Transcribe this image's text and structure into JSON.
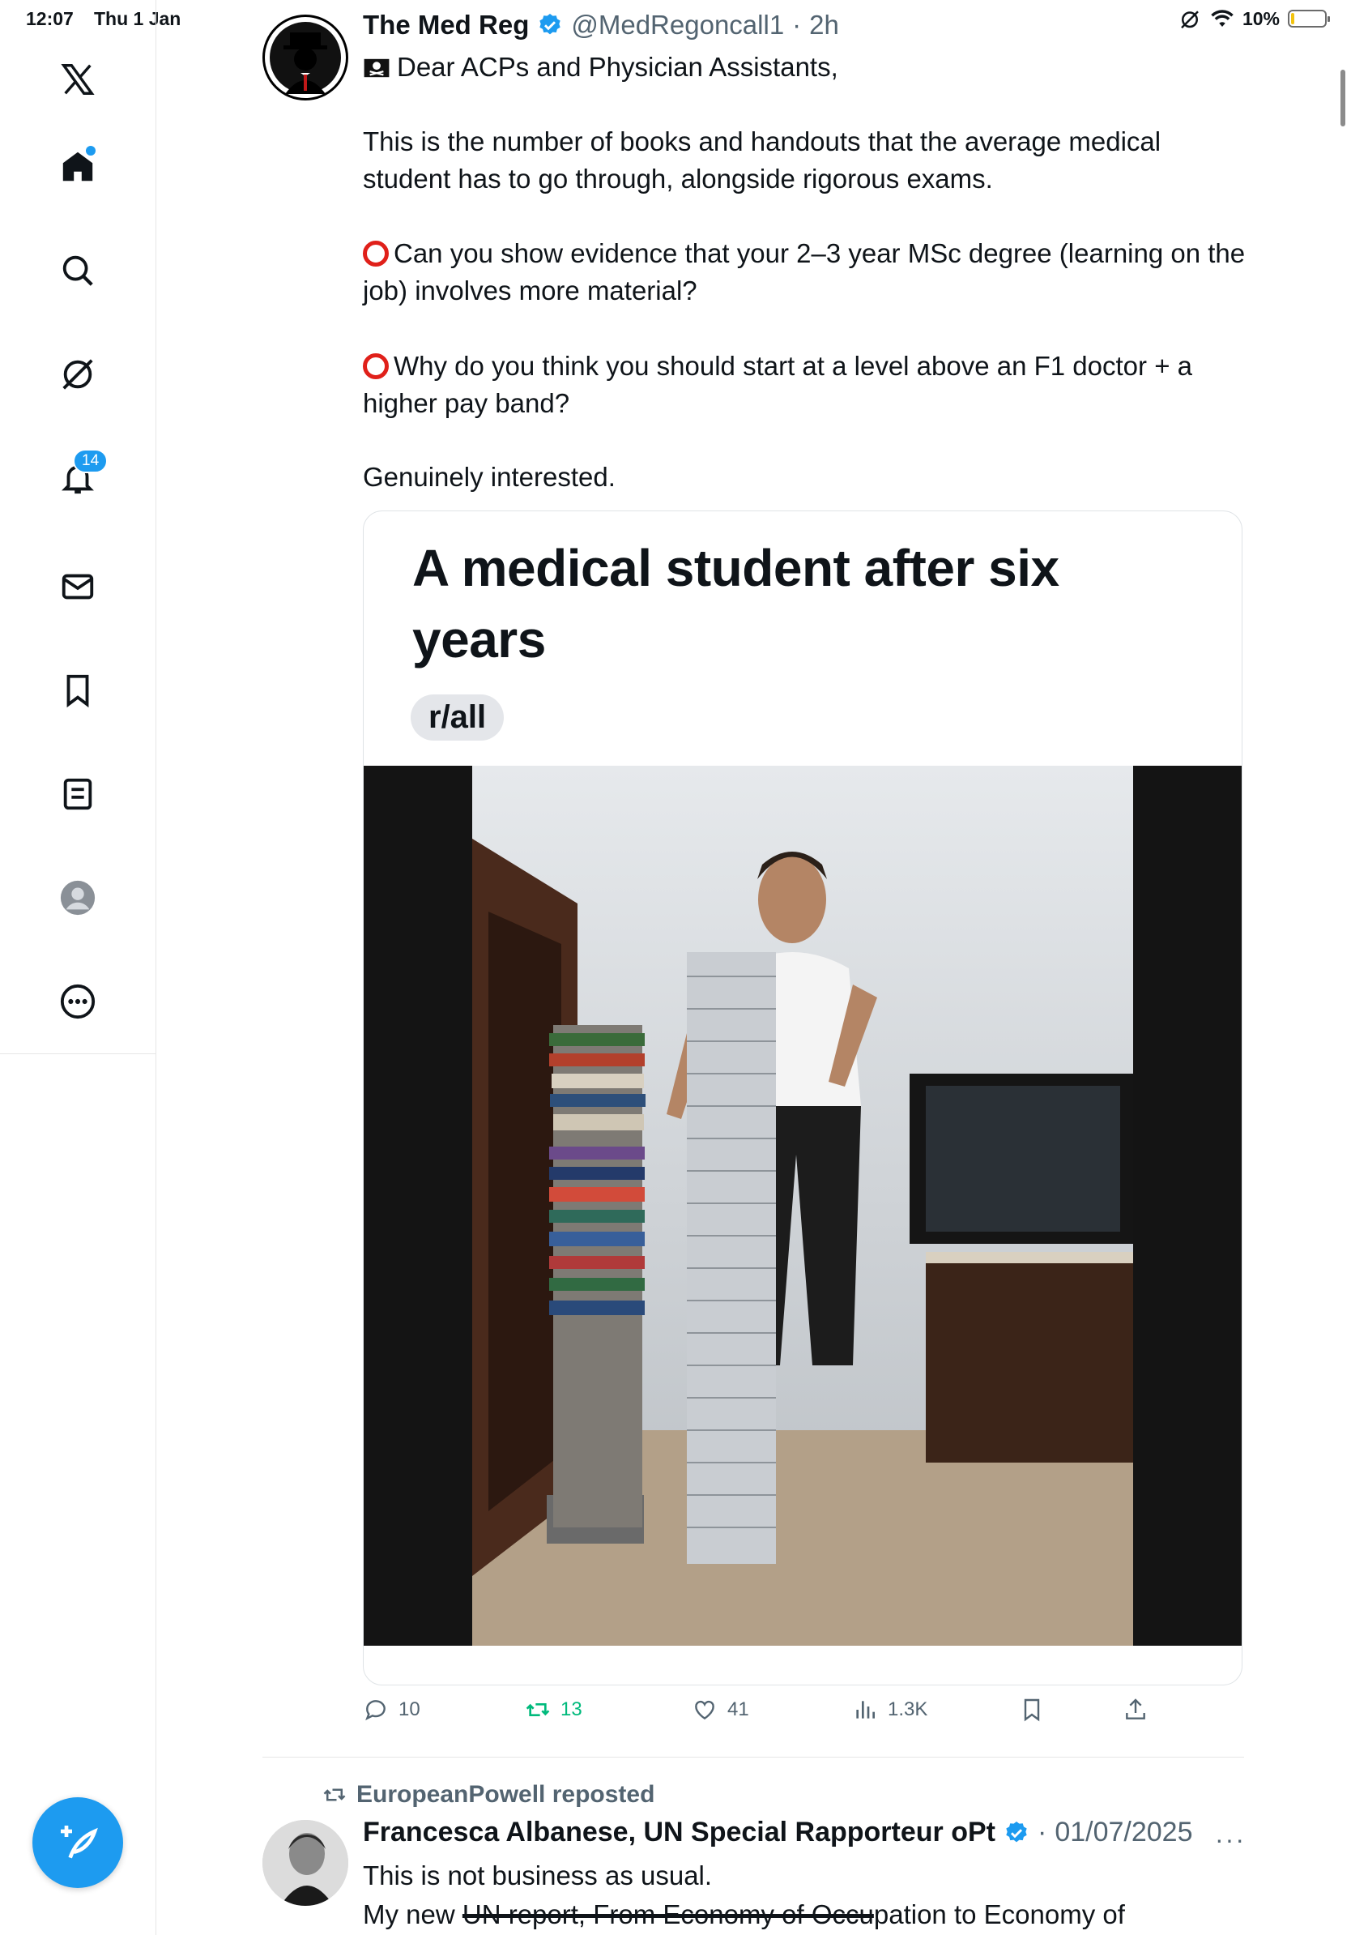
{
  "status_bar": {
    "time": "12:07",
    "date": "Thu 1 Jan",
    "battery_text": "10%",
    "battery_level": 0.1
  },
  "sidebar": {
    "notification_count": "14",
    "accent": "#1d9bf0"
  },
  "tweet": {
    "author_name": "The Med Reg",
    "author_handle": "@MedRegoncall1",
    "time": "2h",
    "separator": "·",
    "line1": "Dear ACPs and Physician Assistants,",
    "para1": "This is the number of books and handouts that the average medical student has to go through, alongside rigorous exams.",
    "para2": "Can you show evidence that your 2–3 year MSc degree (learning on the job) involves more material?",
    "para3": "Why do you think you should start at a level above an F1 doctor + a higher pay band?",
    "para4": "Genuinely interested.",
    "card_title": "A medical student after six years",
    "card_chip": "r/all",
    "actions": {
      "replies": "10",
      "reposts": "13",
      "likes": "41",
      "views": "1.3K"
    }
  },
  "tweet2": {
    "reposted_by": "EuropeanPowell reposted",
    "author_name": "Francesca Albanese, UN Special Rapporteur oPt",
    "time": "01/07/2025",
    "separator": "·",
    "line1": "This is not business as usual.",
    "line2_prefix": "My new ",
    "line2_struck": "UN report, From Economy of Occu",
    "line2_suffix": "pation to Economy of",
    "more": "···"
  },
  "colors": {
    "repost_green": "#00ba7c",
    "muted": "#536471",
    "ring_red": "#e0201a"
  }
}
